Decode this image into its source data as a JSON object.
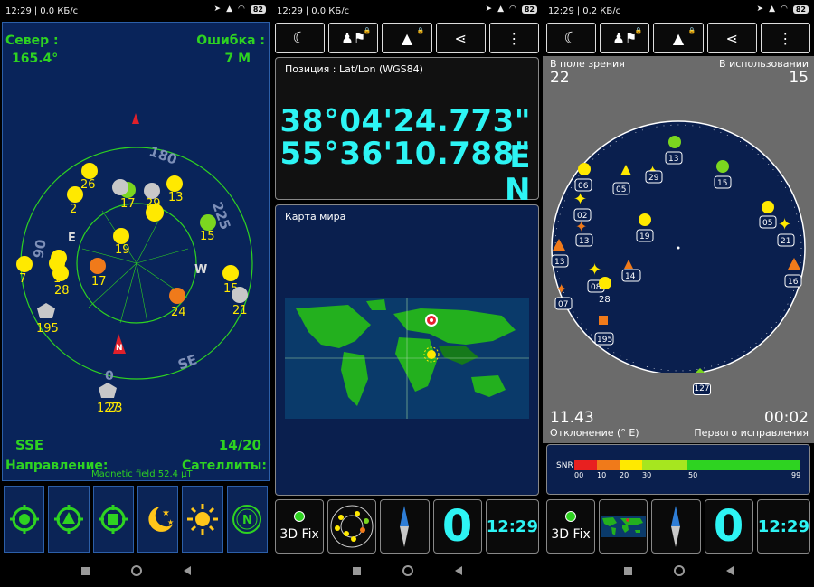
{
  "status": {
    "p1": {
      "time": "12:29",
      "speed": "0,0 КБ/с",
      "battery": "82"
    },
    "p2": {
      "time": "12:29",
      "speed": "0,0 КБ/с",
      "battery": "82"
    },
    "p3": {
      "time": "12:29",
      "speed": "0,2 КБ/с",
      "battery": "82"
    }
  },
  "radar": {
    "north_label": "Север :",
    "north_value": "165.4°",
    "error_label": "Ошибка :",
    "error_value": "7 M",
    "direction_value": "SSE",
    "satellites_value": "14/20",
    "direction_label": "Направление:",
    "magnetic": "Magnetic field 52.4 µT",
    "satellites_label": "Сателлиты:",
    "compass": {
      "s": "180",
      "sw": "225",
      "w": "W",
      "se": "SE",
      "e": "E",
      "n": "N",
      "ne": "90",
      "nw": "0"
    },
    "sats": [
      {
        "id": "26"
      },
      {
        "id": "2"
      },
      {
        "id": "17"
      },
      {
        "id": "29"
      },
      {
        "id": "13"
      },
      {
        "id": "15"
      },
      {
        "id": "19"
      },
      {
        "id": "7"
      },
      {
        "id": "1"
      },
      {
        "id": "28"
      },
      {
        "id": "17"
      },
      {
        "id": "24"
      },
      {
        "id": "15"
      },
      {
        "id": "21"
      },
      {
        "id": "195"
      },
      {
        "id": "127"
      },
      {
        "id": "23"
      }
    ],
    "icons": [
      "gps-target-icon",
      "gps-triangle-icon",
      "gps-square-icon",
      "moon-stars-icon",
      "sun-icon",
      "compass-n-icon"
    ]
  },
  "position": {
    "title": "Позиция : Lat/Lon (WGS84)",
    "lon": "38°04'24.773\" E",
    "lat": "55°36'10.788\" N"
  },
  "worldmap": {
    "title": "Карта мира"
  },
  "tiles": {
    "fix": "3D Fix",
    "zero": "0",
    "time": "12:29"
  },
  "skyview": {
    "in_view_label": "В поле зрения",
    "in_view_value": "22",
    "in_use_label": "В использовании",
    "in_use_value": "15",
    "declination_value": "11.43",
    "declination_label": "Отклонение (° E)",
    "first_fix_value": "00:02",
    "first_fix_label": "Первого исправления",
    "sats": [
      {
        "id": "13"
      },
      {
        "id": "06"
      },
      {
        "id": "05"
      },
      {
        "id": "29"
      },
      {
        "id": "15"
      },
      {
        "id": "02"
      },
      {
        "id": "13"
      },
      {
        "id": "19"
      },
      {
        "id": "05"
      },
      {
        "id": "21"
      },
      {
        "id": "13"
      },
      {
        "id": "14"
      },
      {
        "id": "08"
      },
      {
        "id": "28"
      },
      {
        "id": "16"
      },
      {
        "id": "07"
      },
      {
        "id": "195"
      },
      {
        "id": "127"
      }
    ]
  },
  "snr": {
    "label": "SNR",
    "ticks": [
      "00",
      "10",
      "20",
      "30",
      "50",
      "99"
    ]
  },
  "colors": {
    "accent_green": "#2ed321",
    "cyan": "#2df4f4",
    "navy": "#0a1f4e",
    "sat_yellow": "#ffe900",
    "sat_orange": "#f07a1a",
    "sat_gray": "#c8c8c8"
  }
}
